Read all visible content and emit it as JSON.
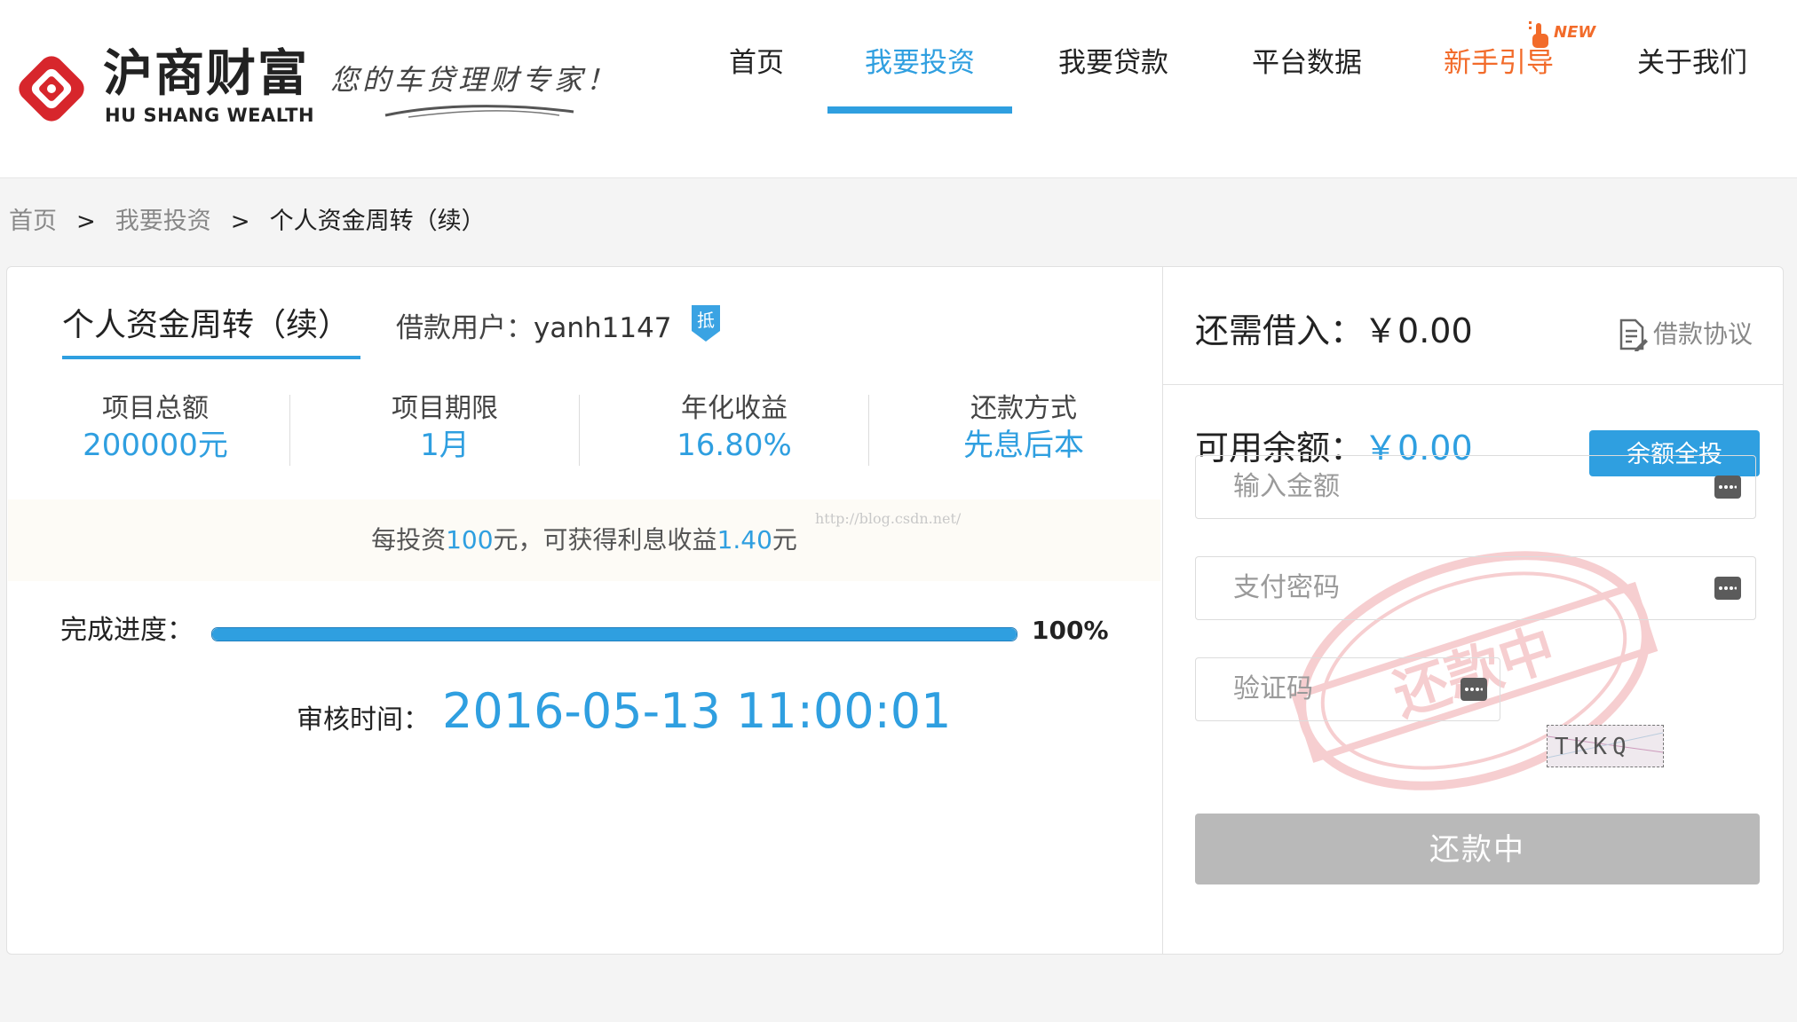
{
  "brand": {
    "name_cn": "沪商财富",
    "name_en": "HU SHANG WEALTH",
    "slogan": "您的车贷理财专家！",
    "logo_color": "#d7262c"
  },
  "nav": {
    "items": [
      {
        "label": "首页"
      },
      {
        "label": "我要投资"
      },
      {
        "label": "我要贷款"
      },
      {
        "label": "平台数据"
      },
      {
        "label": "新手引导"
      },
      {
        "label": "关于我们"
      }
    ],
    "new_badge": "NEW",
    "active_color": "#2f9fe0",
    "hot_color": "#f26b2a"
  },
  "breadcrumb": {
    "home": "首页",
    "invest": "我要投资",
    "current": "个人资金周转（续）",
    "separator": ">"
  },
  "project": {
    "title": "个人资金周转（续）",
    "borrower_label": "借款用户：",
    "borrower_name": "yanh1147",
    "mortgage_badge": "抵",
    "stats": [
      {
        "label": "项目总额",
        "value": "200000元"
      },
      {
        "label": "项目期限",
        "value": "1月"
      },
      {
        "label": "年化收益",
        "value": "16.80%"
      },
      {
        "label": "还款方式",
        "value": "先息后本"
      }
    ],
    "tip": {
      "prefix": "每投资",
      "amount": "100",
      "middle": "元，可获得利息收益",
      "interest": "1.40",
      "suffix": "元"
    },
    "watermark_url": "http://blog.csdn.net/",
    "progress_label": "完成进度：",
    "progress_percent": 100,
    "progress_text": "100%",
    "audit_label": "审核时间：",
    "audit_time": "2016-05-13 11:00:01"
  },
  "invest_panel": {
    "need_label": "还需借入：",
    "need_value": "￥0.00",
    "agreement_label": "借款协议",
    "available_label": "可用余额：",
    "available_value": "￥0.00",
    "all_in_label": "余额全投",
    "amount_placeholder": "输入金额",
    "password_placeholder": "支付密码",
    "captcha_placeholder": "验证码",
    "captcha_text": "TKKQ",
    "status_button": "还款中",
    "stamp_text": "还款中"
  }
}
